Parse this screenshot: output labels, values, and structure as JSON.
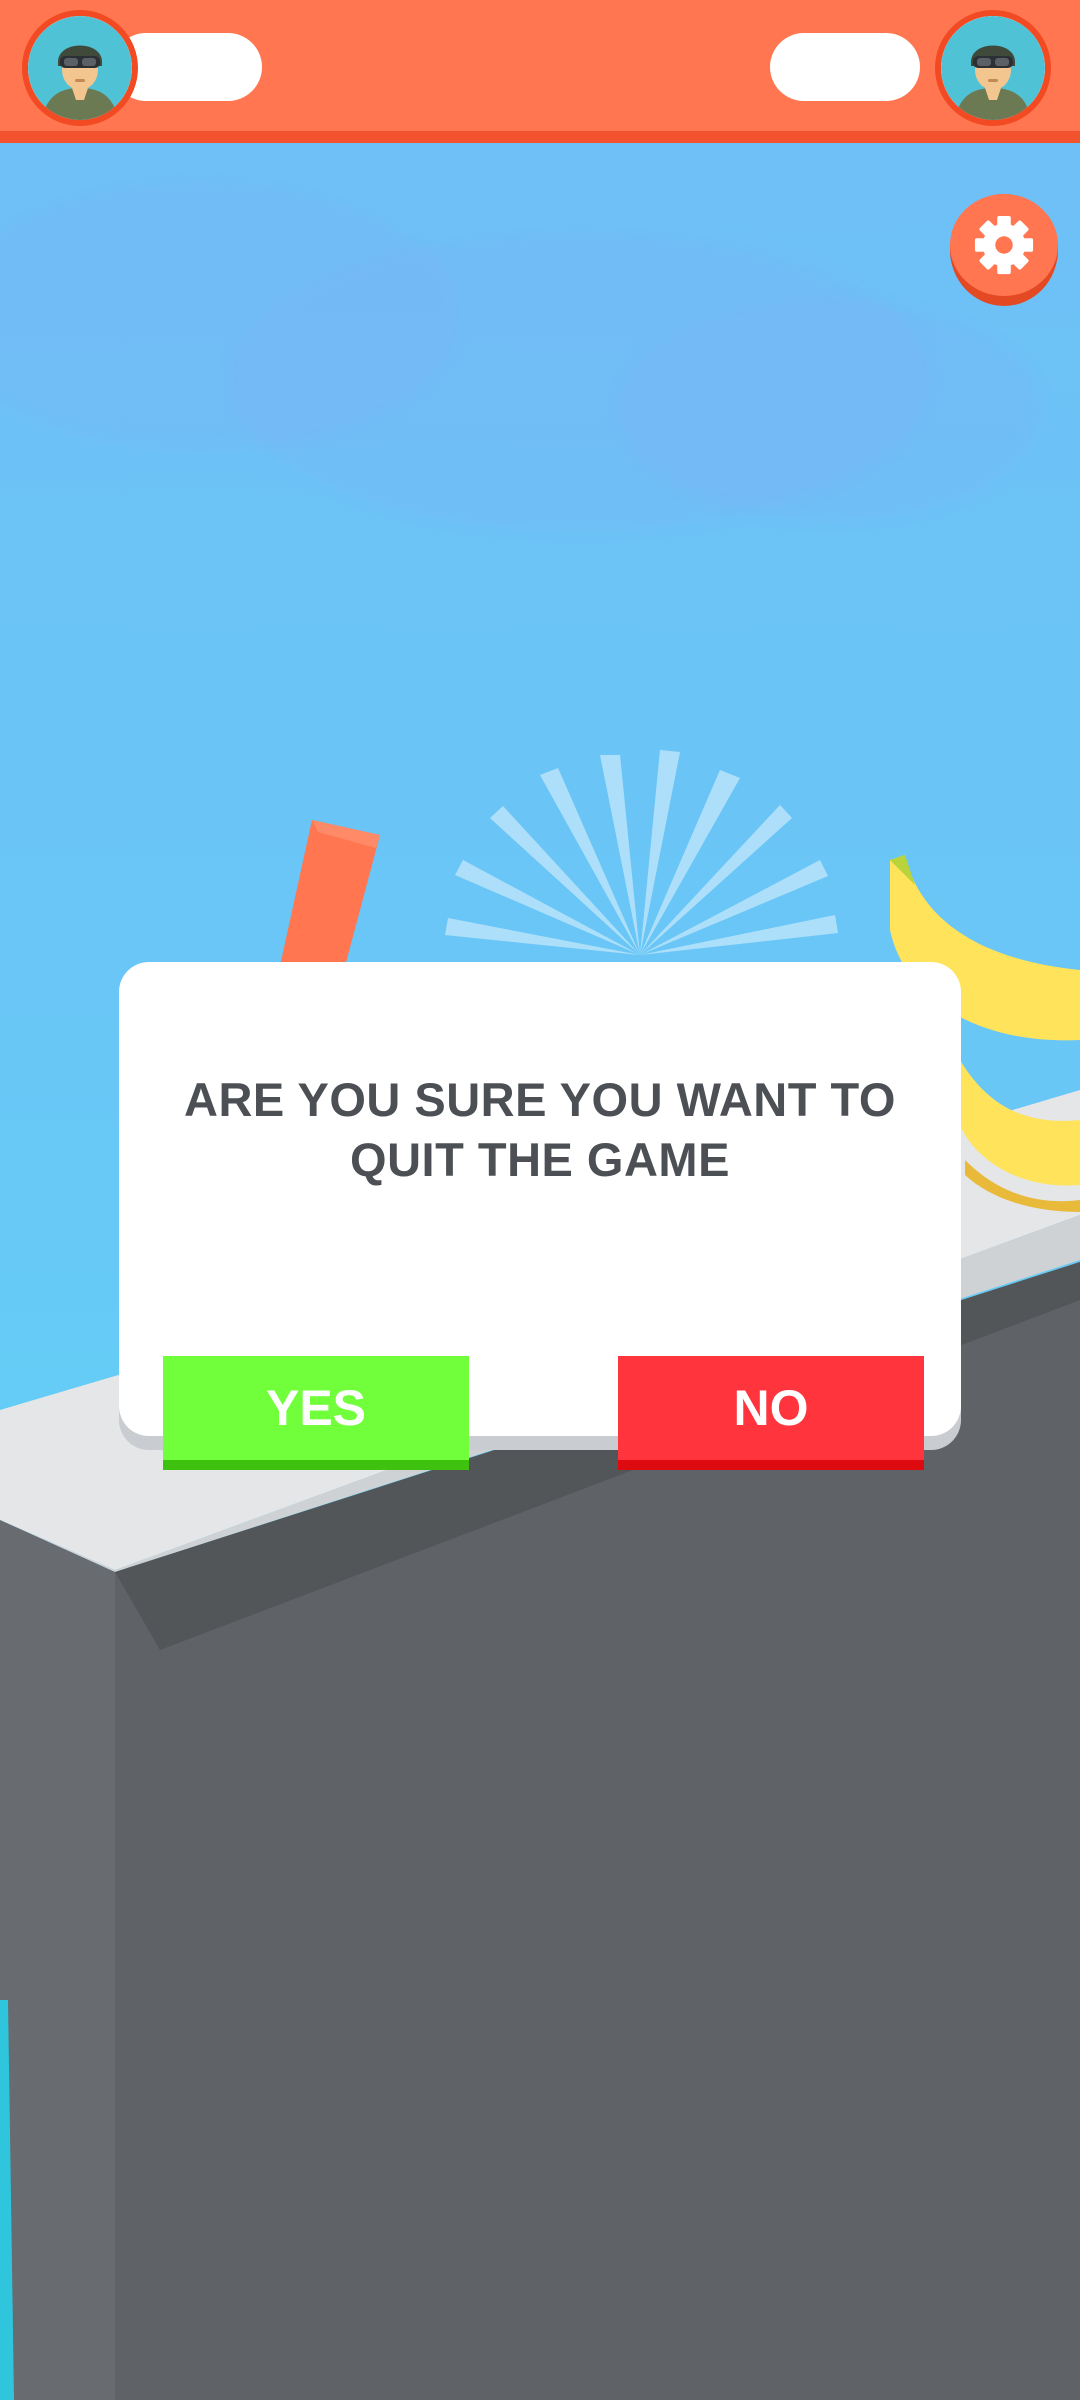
{
  "dialog": {
    "message": "ARE YOU SURE YOU WANT TO QUIT THE GAME",
    "yes_label": "YES",
    "no_label": "NO"
  },
  "players": {
    "left_avatar_icon": "soldier-avatar-icon",
    "right_avatar_icon": "soldier-avatar-icon"
  },
  "icons": {
    "settings": "gear-icon"
  },
  "colors": {
    "topbar": "#ff7650",
    "yes_button": "#72ff3b",
    "no_button": "#ff343d",
    "sky": "#6fbff6",
    "table": "#5f6266"
  }
}
